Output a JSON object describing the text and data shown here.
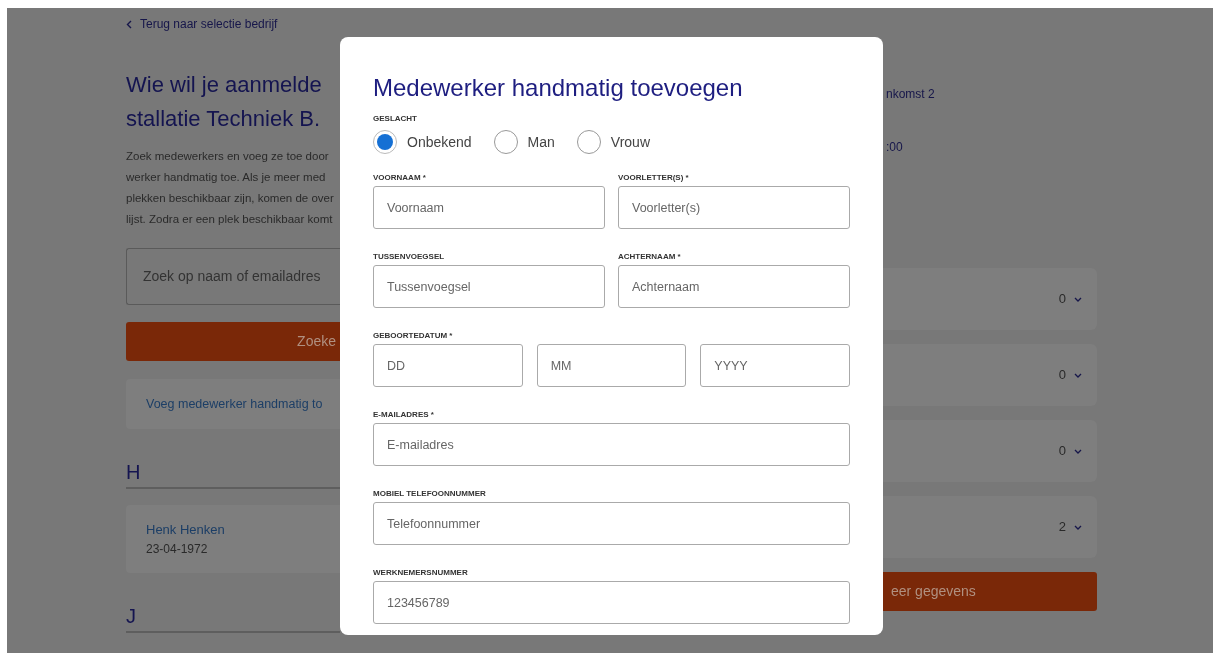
{
  "back_link": {
    "label": "Terug naar selectie bedrijf"
  },
  "page": {
    "heading_lines": [
      "Wie wil je aanmelde",
      "stallatie Techniek B."
    ],
    "intro_lines": [
      "Zoek medewerkers en voeg ze toe door",
      "werker handmatig toe. Als je meer med",
      "plekken beschikbaar zijn, komen de over",
      "lijst. Zodra er een plek beschikbaar komt"
    ],
    "search": {
      "placeholder": "Zoek op naam of emailadres"
    },
    "search_button": "Zoeke",
    "add_manual_link": "Voeg medewerker handmatig to",
    "groups": [
      {
        "letter": "H",
        "employees": [
          {
            "name": "Henk Henken",
            "birth_date": "23-04-1972"
          }
        ]
      },
      {
        "letter": "J"
      }
    ]
  },
  "summary": {
    "lines": [
      "nkomst 2",
      ":00"
    ],
    "rows": [
      {
        "count": "0"
      },
      {
        "count": "0"
      },
      {
        "count": "0"
      },
      {
        "count": "2"
      }
    ],
    "button": "eer gegevens"
  },
  "modal": {
    "title": "Medewerker handmatig toevoegen",
    "gender": {
      "label": "GESLACHT",
      "options": [
        {
          "label": "Onbekend",
          "selected": true
        },
        {
          "label": "Man",
          "selected": false
        },
        {
          "label": "Vrouw",
          "selected": false
        }
      ]
    },
    "rows": [
      [
        {
          "label": "VOORNAAM *",
          "inputs": [
            {
              "placeholder": "Voornaam"
            }
          ]
        },
        {
          "label": "VOORLETTER(S) *",
          "inputs": [
            {
              "placeholder": "Voorletter(s)"
            }
          ]
        }
      ],
      [
        {
          "label": "TUSSENVOEGSEL",
          "inputs": [
            {
              "placeholder": "Tussenvoegsel"
            }
          ]
        },
        {
          "label": "ACHTERNAAM *",
          "inputs": [
            {
              "placeholder": "Achternaam"
            }
          ]
        }
      ],
      [
        {
          "label": "GEBOORTEDATUM *",
          "inputs": [
            {
              "placeholder": "DD"
            },
            {
              "placeholder": "MM"
            },
            {
              "placeholder": "YYYY"
            }
          ]
        }
      ],
      [
        {
          "label": "E-MAILADRES *",
          "inputs": [
            {
              "placeholder": "E-mailadres"
            }
          ]
        }
      ],
      [
        {
          "label": "MOBIEL TELEFOONNUMMER",
          "inputs": [
            {
              "placeholder": "Telefoonnummer"
            }
          ]
        }
      ],
      [
        {
          "label": "WERKNEMERSNUMMER",
          "inputs": [
            {
              "placeholder": "123456789"
            }
          ]
        }
      ]
    ]
  }
}
